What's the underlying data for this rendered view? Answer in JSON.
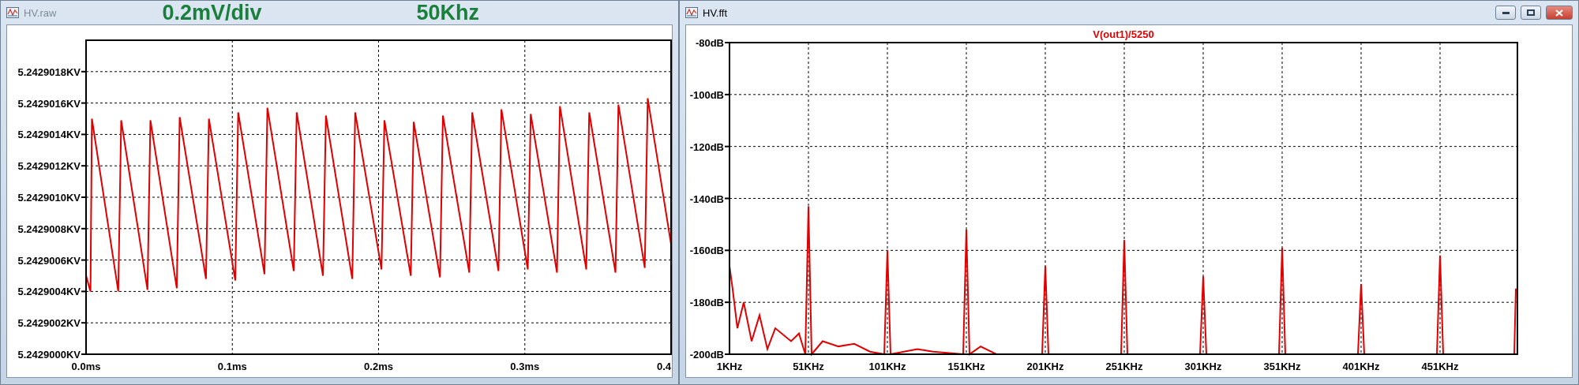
{
  "windows": [
    {
      "title": "HV.raw",
      "active": false,
      "annotations": [
        "0.2mV/div",
        "50Khz"
      ],
      "chart_data": {
        "type": "line",
        "x": [
          0,
          0.003,
          0.004,
          0.022,
          0.024,
          0.042,
          0.044,
          0.062,
          0.064,
          0.082,
          0.084,
          0.102,
          0.104,
          0.122,
          0.124,
          0.142,
          0.144,
          0.162,
          0.164,
          0.182,
          0.184,
          0.202,
          0.204,
          0.222,
          0.224,
          0.242,
          0.244,
          0.262,
          0.264,
          0.282,
          0.284,
          0.302,
          0.304,
          0.322,
          0.324,
          0.342,
          0.344,
          0.362,
          0.364,
          0.382,
          0.384,
          0.4
        ],
        "grid": true,
        "series": [
          {
            "color": "#e00000",
            "values": [
              5.2429005,
              5.2429004,
              5.2429015,
              5.2429004,
              5.24290149,
              5.24290041,
              5.24290149,
              5.24290042,
              5.24290151,
              5.24290048,
              5.2429015,
              5.24290047,
              5.24290154,
              5.24290051,
              5.24290157,
              5.24290053,
              5.24290154,
              5.2429005,
              5.24290152,
              5.24290048,
              5.24290154,
              5.24290054,
              5.24290149,
              5.2429005,
              5.24290148,
              5.24290049,
              5.24290152,
              5.24290052,
              5.24290154,
              5.24290053,
              5.24290156,
              5.24290054,
              5.24290153,
              5.24290052,
              5.24290158,
              5.24290054,
              5.24290154,
              5.24290052,
              5.24290159,
              5.24290055,
              5.24290163,
              5.2429007
            ]
          }
        ],
        "xlim": [
          0,
          0.4
        ],
        "ylim": [
          5.2429,
          5.242902
        ],
        "xticks": [
          {
            "value": 0,
            "label": "0.0ms"
          },
          {
            "value": 0.1,
            "label": "0.1ms"
          },
          {
            "value": 0.2,
            "label": "0.2ms"
          },
          {
            "value": 0.3,
            "label": "0.3ms"
          },
          {
            "value": 0.4,
            "label": "0.4"
          }
        ],
        "yticks": [
          {
            "value": 5.2429,
            "label": "5.2429000KV"
          },
          {
            "value": 5.2429002,
            "label": "5.2429002KV"
          },
          {
            "value": 5.2429004,
            "label": "5.2429004KV"
          },
          {
            "value": 5.2429006,
            "label": "5.2429006KV"
          },
          {
            "value": 5.2429008,
            "label": "5.2429008KV"
          },
          {
            "value": 5.242901,
            "label": "5.2429010KV"
          },
          {
            "value": 5.2429012,
            "label": "5.2429012KV"
          },
          {
            "value": 5.2429014,
            "label": "5.2429014KV"
          },
          {
            "value": 5.2429016,
            "label": "5.2429016KV"
          },
          {
            "value": 5.2429018,
            "label": "5.2429018KV"
          }
        ]
      }
    },
    {
      "title": "HV.fft",
      "active": true,
      "window_buttons": true,
      "chart_data": {
        "type": "line",
        "title": "V(out1)/5250",
        "x": [
          1,
          3,
          6,
          10,
          15,
          20,
          25,
          30,
          40,
          45,
          49,
          51,
          53,
          60,
          70,
          80,
          90,
          99,
          101,
          103,
          120,
          130,
          149,
          151,
          153,
          160,
          170,
          199,
          201,
          203,
          249,
          251,
          253,
          299,
          301,
          303,
          349,
          351,
          353,
          399,
          401,
          403,
          449,
          451,
          453,
          498,
          499,
          500
        ],
        "grid": true,
        "series": [
          {
            "color": "#e00000",
            "values": [
              -166,
              -175,
              -190,
              -180,
              -195,
              -185,
              -198,
              -190,
              -195,
              -192,
              -200,
              -143,
              -200,
              -195,
              -197,
              -196,
              -199,
              -200,
              -160,
              -200,
              -198,
              -199,
              -200,
              -152,
              -200,
              -197,
              -200,
              -200,
              -166,
              -200,
              -200,
              -156,
              -200,
              -200,
              -170,
              -200,
              -200,
              -159,
              -200,
              -200,
              -173,
              -200,
              -200,
              -162,
              -200,
              -200,
              -175,
              -175
            ]
          }
        ],
        "xlim": [
          1,
          500
        ],
        "ylim": [
          -200,
          -80
        ],
        "xticks": [
          {
            "value": 1,
            "label": "1KHz"
          },
          {
            "value": 51,
            "label": "51KHz"
          },
          {
            "value": 101,
            "label": "101KHz"
          },
          {
            "value": 151,
            "label": "151KHz"
          },
          {
            "value": 201,
            "label": "201KHz"
          },
          {
            "value": 251,
            "label": "251KHz"
          },
          {
            "value": 301,
            "label": "301KHz"
          },
          {
            "value": 351,
            "label": "351KHz"
          },
          {
            "value": 401,
            "label": "401KHz"
          },
          {
            "value": 451,
            "label": "451KHz"
          }
        ],
        "yticks": [
          {
            "value": -200,
            "label": "-200dB"
          },
          {
            "value": -180,
            "label": "-180dB"
          },
          {
            "value": -160,
            "label": "-160dB"
          },
          {
            "value": -140,
            "label": "-140dB"
          },
          {
            "value": -120,
            "label": "-120dB"
          },
          {
            "value": -100,
            "label": "-100dB"
          },
          {
            "value": -80,
            "label": "-80dB"
          }
        ]
      }
    }
  ]
}
